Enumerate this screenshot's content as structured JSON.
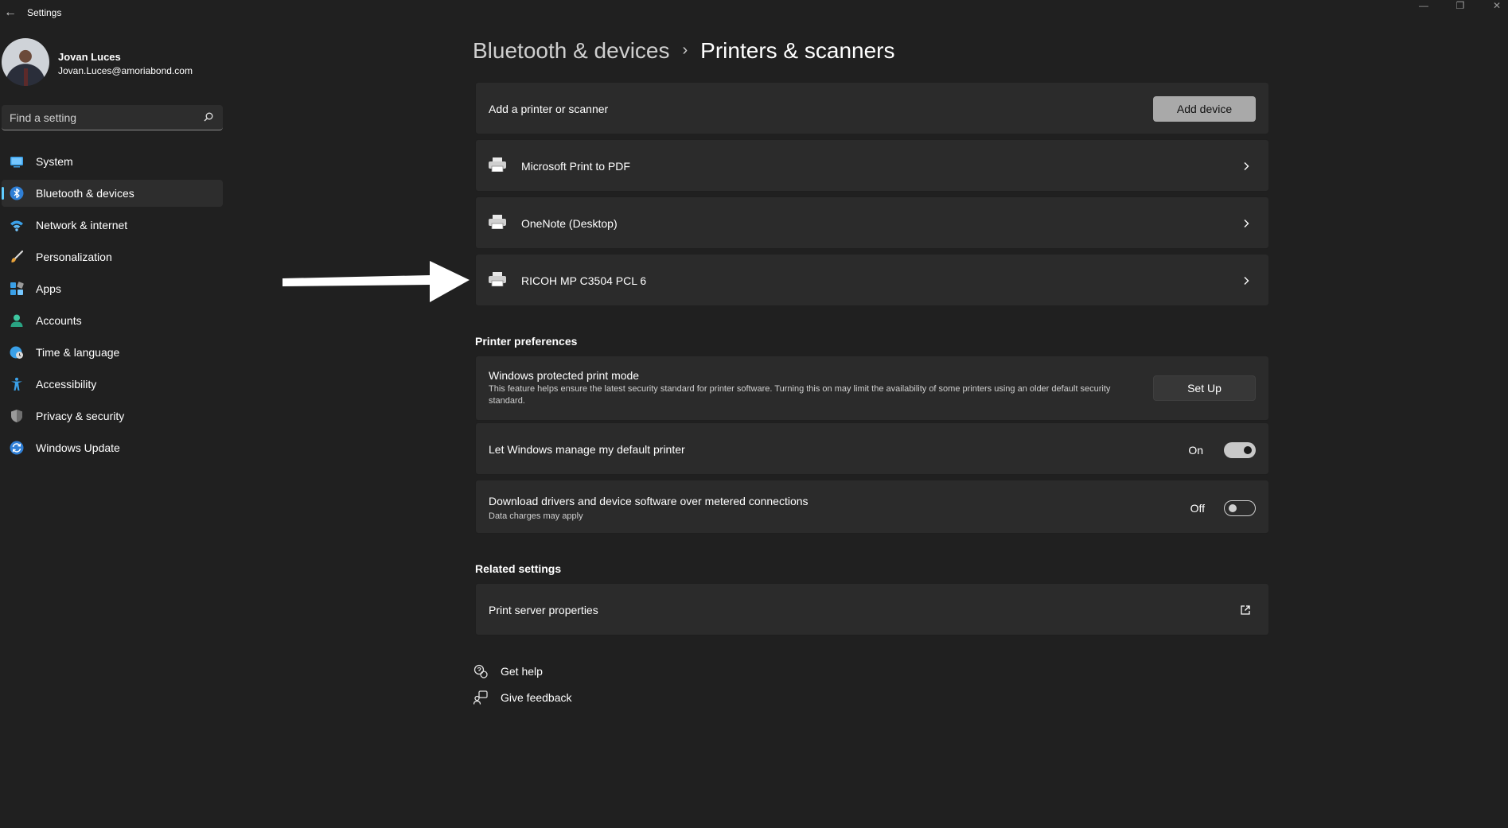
{
  "window": {
    "title": "Settings",
    "back_glyph": "←",
    "minimize_glyph": "—",
    "maximize_glyph": "❐",
    "close_glyph": "✕"
  },
  "profile": {
    "name": "Jovan Luces",
    "email": "Jovan.Luces@amoriabond.com"
  },
  "search": {
    "placeholder": "Find a setting",
    "icon": "search-icon"
  },
  "sidebar": {
    "items": [
      {
        "label": "System",
        "icon": "system-icon",
        "active": false
      },
      {
        "label": "Bluetooth & devices",
        "icon": "bluetooth-icon",
        "active": true
      },
      {
        "label": "Network & internet",
        "icon": "wifi-icon",
        "active": false
      },
      {
        "label": "Personalization",
        "icon": "brush-icon",
        "active": false
      },
      {
        "label": "Apps",
        "icon": "apps-icon",
        "active": false
      },
      {
        "label": "Accounts",
        "icon": "accounts-icon",
        "active": false
      },
      {
        "label": "Time & language",
        "icon": "time-language-icon",
        "active": false
      },
      {
        "label": "Accessibility",
        "icon": "accessibility-icon",
        "active": false
      },
      {
        "label": "Privacy & security",
        "icon": "shield-icon",
        "active": false
      },
      {
        "label": "Windows Update",
        "icon": "windows-update-icon",
        "active": false
      }
    ]
  },
  "breadcrumb": {
    "parent": "Bluetooth & devices",
    "separator": "›",
    "current": "Printers & scanners"
  },
  "add_printer": {
    "label": "Add a printer or scanner",
    "button": "Add device"
  },
  "printers": [
    {
      "name": "Microsoft Print to PDF",
      "icon": "printer-icon"
    },
    {
      "name": "OneNote (Desktop)",
      "icon": "printer-icon"
    },
    {
      "name": "RICOH MP C3504 PCL 6",
      "icon": "printer-icon"
    }
  ],
  "printer_preferences": {
    "heading": "Printer preferences",
    "protected_mode": {
      "title": "Windows protected print mode",
      "description": "This feature helps ensure the latest security standard for printer software. Turning this on may limit the availability of some printers using an older default security standard.",
      "button": "Set Up"
    },
    "default_printer": {
      "title": "Let Windows manage my default printer",
      "state": "On",
      "on": true
    },
    "metered": {
      "title": "Download drivers and device software over metered connections",
      "subtitle": "Data charges may apply",
      "state": "Off",
      "on": false
    }
  },
  "related_settings": {
    "heading": "Related settings",
    "print_server": {
      "label": "Print server properties",
      "icon": "external-link-icon"
    }
  },
  "help": {
    "get_help": "Get help",
    "give_feedback": "Give feedback"
  },
  "colors": {
    "background": "#202020",
    "card": "#2b2b2b",
    "accent": "#60cdff",
    "button_accent": "#a9a9a9"
  }
}
